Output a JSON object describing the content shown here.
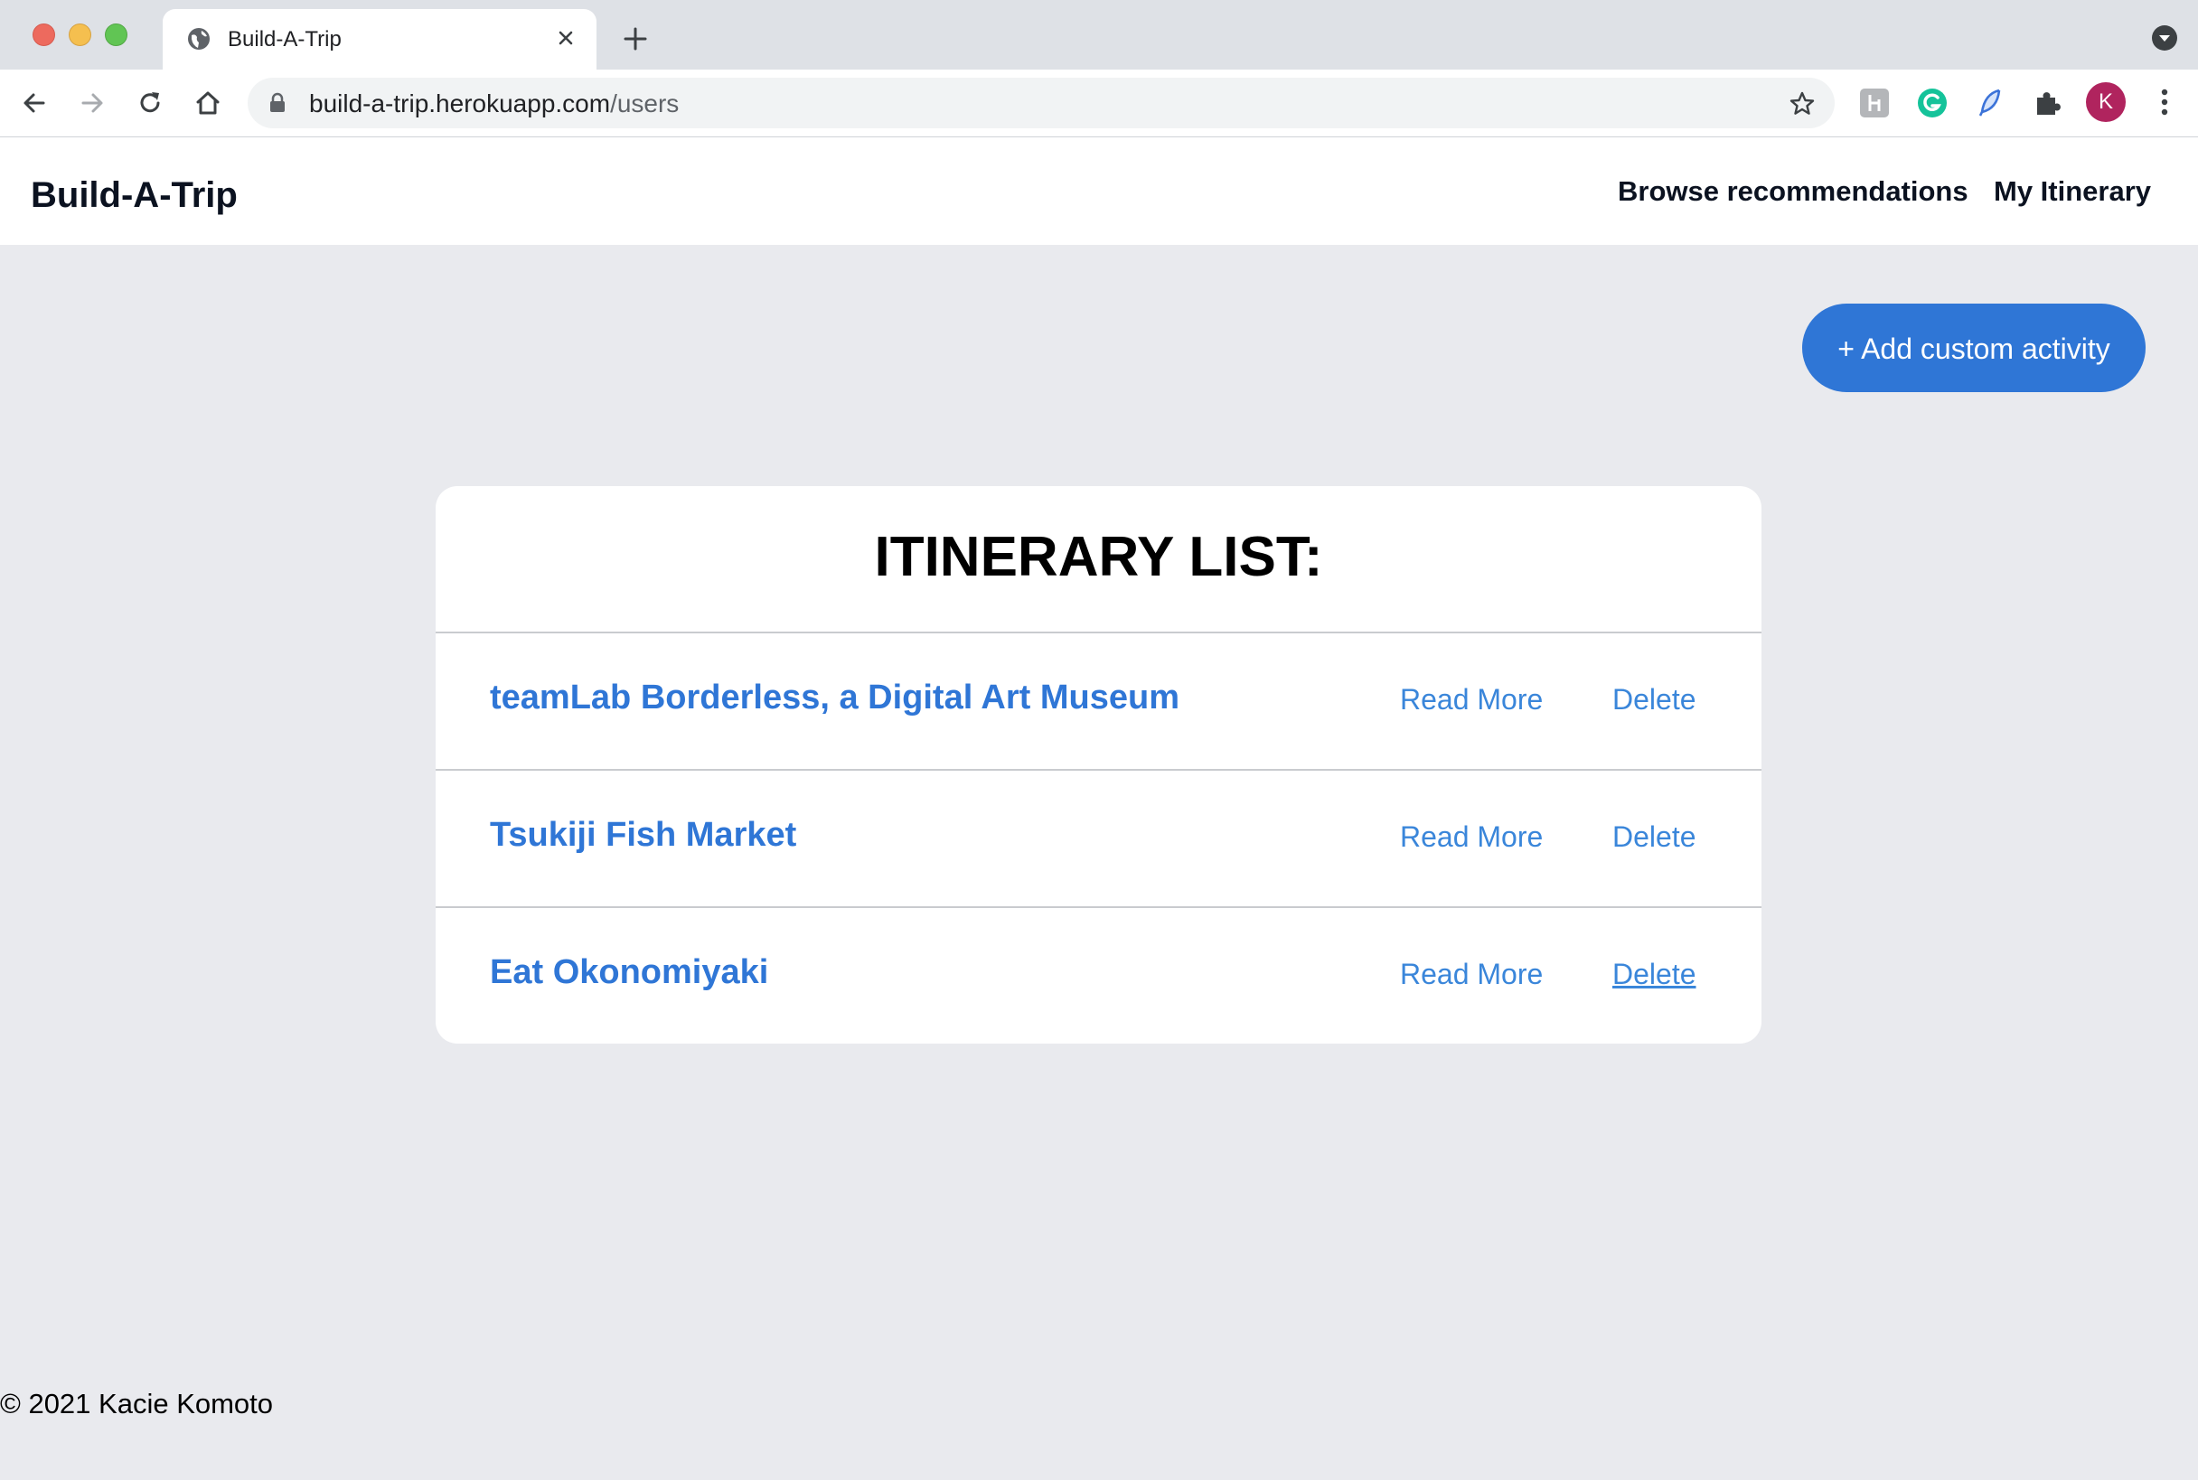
{
  "browser": {
    "tab_title": "Build-A-Trip",
    "url_host": "build-a-trip.herokuapp.com",
    "url_path": "/users",
    "profile_initial": "K"
  },
  "nav": {
    "brand": "Build-A-Trip",
    "links": [
      "Browse recommendations",
      "My Itinerary"
    ]
  },
  "actions": {
    "add_label": "+ Add custom activity"
  },
  "itinerary": {
    "title": "ITINERARY LIST:",
    "items": [
      {
        "title": "teamLab Borderless, a Digital Art Museum",
        "read_more": "Read More",
        "delete": "Delete"
      },
      {
        "title": "Tsukiji Fish Market",
        "read_more": "Read More",
        "delete": "Delete"
      },
      {
        "title": "Eat Okonomiyaki",
        "read_more": "Read More",
        "delete": "Delete"
      }
    ]
  },
  "footer": {
    "text": "© 2021 Kacie Komoto"
  },
  "colors": {
    "accent": "#2f76d6",
    "page_bg": "#e9eaee",
    "card_bg": "#ffffff"
  }
}
